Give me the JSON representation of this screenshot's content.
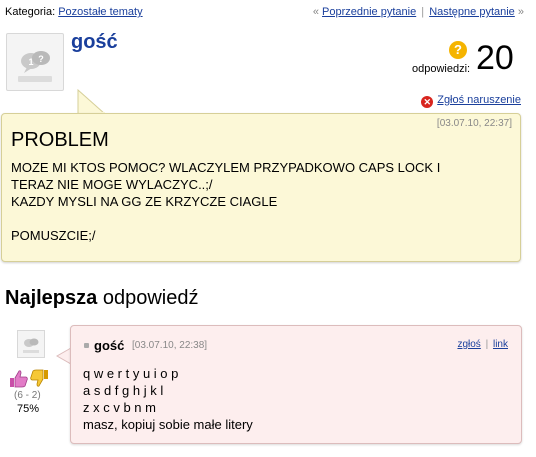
{
  "topbar": {
    "category_label": "Kategoria:",
    "category_link": "Pozostałe tematy",
    "prev_marker": "«",
    "prev_link": "Poprzednie pytanie",
    "separator": "|",
    "next_link": "Następne pytanie",
    "next_marker": "»"
  },
  "question": {
    "author": "gość",
    "count_label": "odpowiedzi:",
    "count": "20",
    "report_label": "Zgłoś naruszenie",
    "date": "[03.07.10, 22:37]",
    "title": "PROBLEM",
    "body": [
      "MOZE MI KTOS POMOC? WLACZYLEM PRZYPADKOWO CAPS LOCK I",
      "TERAZ NIE MOGE WYLACZYC..;/",
      "KAZDY MYSLI NA GG ZE KRZYCZE CIAGLE",
      "",
      "POMUSZCIE;/"
    ]
  },
  "best": {
    "heading_bold": "Najlepsza",
    "heading_rest": "odpowiedź"
  },
  "answer": {
    "author": "gość",
    "date": "[03.07.10, 22:38]",
    "report_link": "zgłoś",
    "separator": "|",
    "link_label": "link",
    "votes": "(6 - 2)",
    "percent": "75%",
    "body": [
      "q w e r t y u i o p",
      "a s d f g h j k l",
      "z x c v b n m",
      "masz, kopiuj sobie małe litery"
    ]
  },
  "icons": {
    "avatar": "avatar-icon",
    "question": "question-mark-icon",
    "report": "report-x-icon",
    "thumb_up": "thumb-up-icon",
    "thumb_down": "thumb-down-icon"
  },
  "colors": {
    "link": "#1a3f9c",
    "question_bg": "#fcf8d7",
    "answer_bg": "#fdeeee",
    "accent_orange": "#f5b400",
    "report_red": "#d8251e"
  }
}
